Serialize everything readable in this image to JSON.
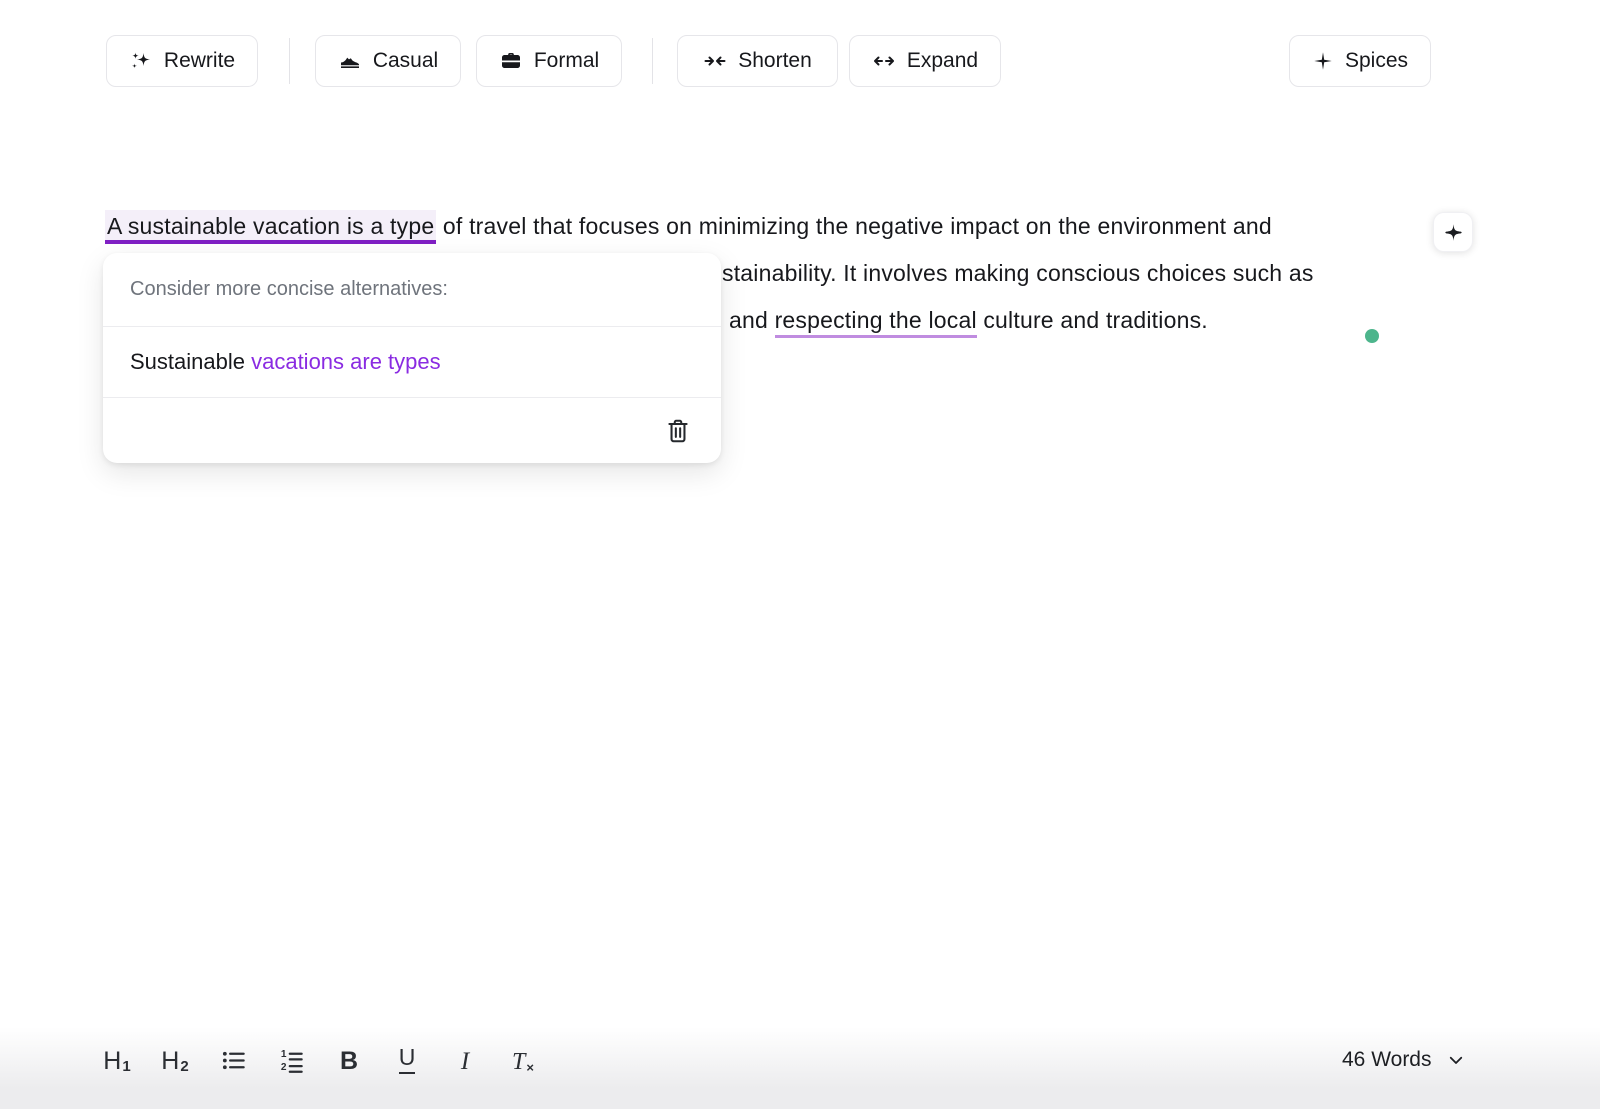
{
  "toolbar": {
    "rewrite_label": "Rewrite",
    "casual_label": "Casual",
    "formal_label": "Formal",
    "shorten_label": "Shorten",
    "expand_label": "Expand",
    "spices_label": "Spices"
  },
  "editor": {
    "line1_highlight": "A sustainable vacation is a type",
    "line1_rest": " of travel that focuses on minimizing the negative impact on the environment and",
    "line2_visible": "stainability. It involves making conscious choices such as",
    "line3_pre": "and ",
    "line3_underlined": "respecting the local",
    "line3_post": " culture and traditions."
  },
  "popup": {
    "header": "Consider more concise alternatives:",
    "suggestion_plain": "Sustainable ",
    "suggestion_highlight": "vacations are types"
  },
  "statusbar": {
    "word_count": "46 Words"
  },
  "icons": {
    "rewrite": "sparkles-icon",
    "casual": "sneaker-icon",
    "formal": "briefcase-icon",
    "shorten": "arrows-inward-icon",
    "expand": "arrows-outward-icon",
    "spices": "four-point-star-icon",
    "floating_button": "four-point-star-icon",
    "popup_delete": "trash-icon",
    "word_count": "chevron-down-icon"
  },
  "colors": {
    "purple_strong": "#8020c4",
    "purple_light": "#c08ce0",
    "highlight_bg": "#f4eff9",
    "suggestion_purple": "#8a2be2",
    "dot_green": "#4db58c"
  }
}
